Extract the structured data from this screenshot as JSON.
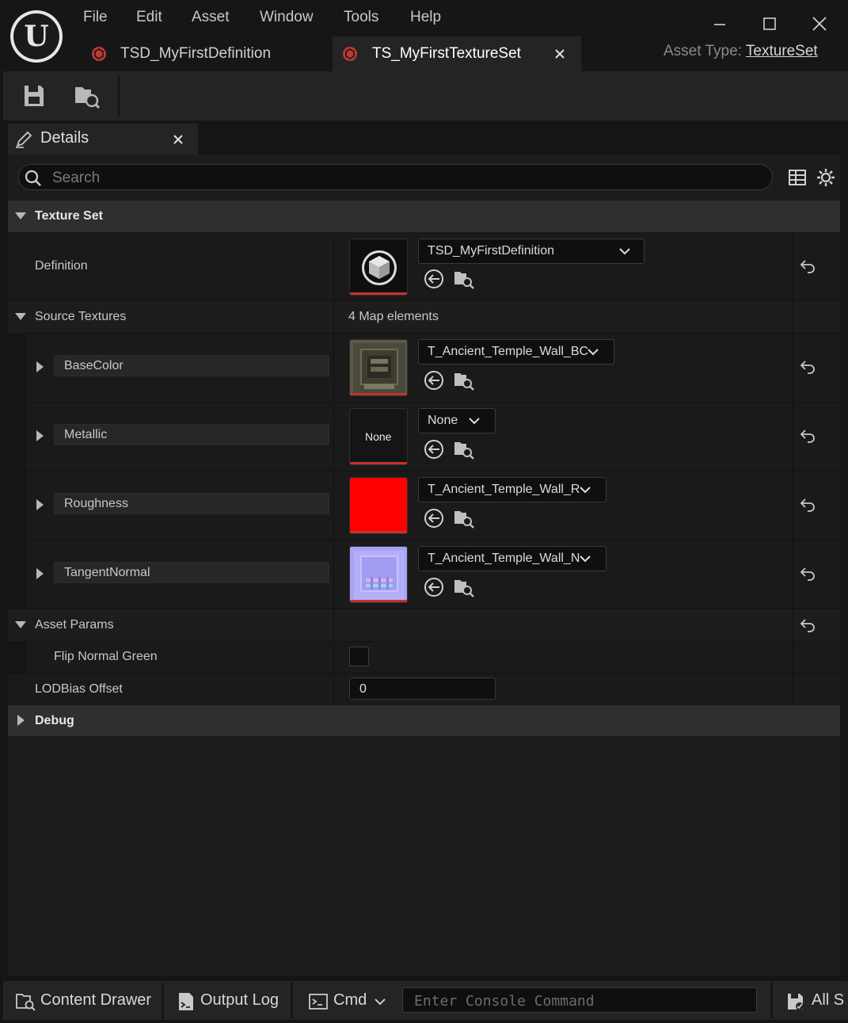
{
  "menu": [
    "File",
    "Edit",
    "Asset",
    "Window",
    "Tools",
    "Help"
  ],
  "tabs": [
    {
      "label": "TSD_MyFirstDefinition",
      "active": false
    },
    {
      "label": "TS_MyFirstTextureSet",
      "active": true
    }
  ],
  "asset_type": {
    "label": "Asset Type:",
    "value": "TextureSet"
  },
  "details": {
    "tab_label": "Details",
    "search_placeholder": "Search",
    "categories": {
      "texture_set": "Texture Set",
      "source_textures": "Source Textures",
      "asset_params": "Asset Params",
      "debug": "Debug"
    },
    "definition": {
      "label": "Definition",
      "value": "TSD_MyFirstDefinition"
    },
    "source_textures_count": "4 Map elements",
    "maps": [
      {
        "name": "BaseColor",
        "texture": "T_Ancient_Temple_Wall_BC",
        "thumb": "basecolor"
      },
      {
        "name": "Metallic",
        "texture": "None",
        "thumb": "none",
        "thumb_text": "None"
      },
      {
        "name": "Roughness",
        "texture": "T_Ancient_Temple_Wall_R",
        "thumb": "red",
        "color": "#ff0000"
      },
      {
        "name": "TangentNormal",
        "texture": "T_Ancient_Temple_Wall_N",
        "thumb": "normal"
      }
    ],
    "flip_normal_green": {
      "label": "Flip Normal Green",
      "checked": false
    },
    "lod_bias": {
      "label": "LODBias Offset",
      "value": "0"
    }
  },
  "statusbar": {
    "content_drawer": "Content Drawer",
    "output_log": "Output Log",
    "cmd": "Cmd",
    "console_placeholder": "Enter Console Command",
    "all_saved": "All Saved"
  },
  "colors": {
    "accent_red": "#c33232",
    "panel_bg": "#1c1c1c",
    "category_bg": "#2f2f2f"
  }
}
